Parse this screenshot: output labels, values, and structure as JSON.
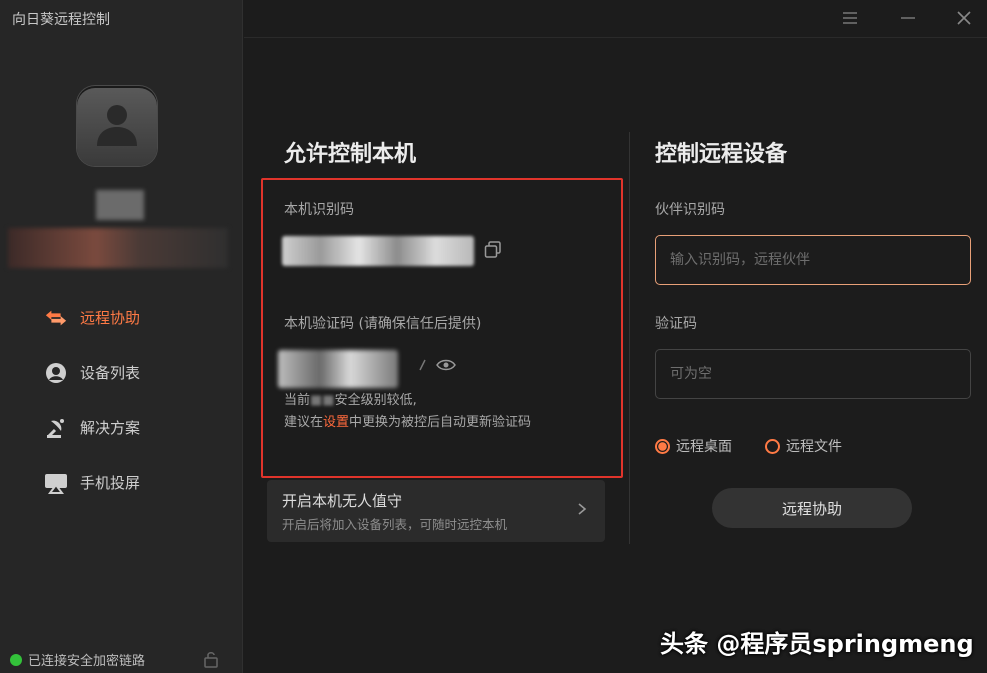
{
  "app": {
    "title": "向日葵远程控制"
  },
  "sidebar": {
    "items": [
      {
        "label": "远程协助",
        "icon": "remote-assist-icon",
        "active": true
      },
      {
        "label": "设备列表",
        "icon": "device-list-icon",
        "active": false
      },
      {
        "label": "解决方案",
        "icon": "solution-icon",
        "active": false
      },
      {
        "label": "手机投屏",
        "icon": "screen-cast-icon",
        "active": false
      }
    ],
    "status": "已连接安全加密链路"
  },
  "allow_control": {
    "title": "允许控制本机",
    "id_label": "本机识别码",
    "code_label": "本机验证码 (请确保信任后提供)",
    "notice_line1_prefix": "当前",
    "notice_line1_suffix": "安全级别较低,",
    "notice_line2_prefix": "建议在",
    "notice_link": "设置",
    "notice_line2_suffix": "中更换为被控后自动更新验证码",
    "unattended_title": "开启本机无人值守",
    "unattended_desc": "开启后将加入设备列表，可随时远控本机"
  },
  "control_remote": {
    "title": "控制远程设备",
    "partner_label": "伙伴识别码",
    "partner_placeholder": "输入识别码，远程伙伴",
    "code_label": "验证码",
    "code_placeholder": "可为空",
    "radio_desktop": "远程桌面",
    "radio_file": "远程文件",
    "connect_button": "远程协助"
  },
  "watermark": "头条 @程序员springmeng",
  "colors": {
    "accent": "#ff7a45",
    "highlight_box": "#e0342b",
    "status_ok": "#33c13a"
  }
}
